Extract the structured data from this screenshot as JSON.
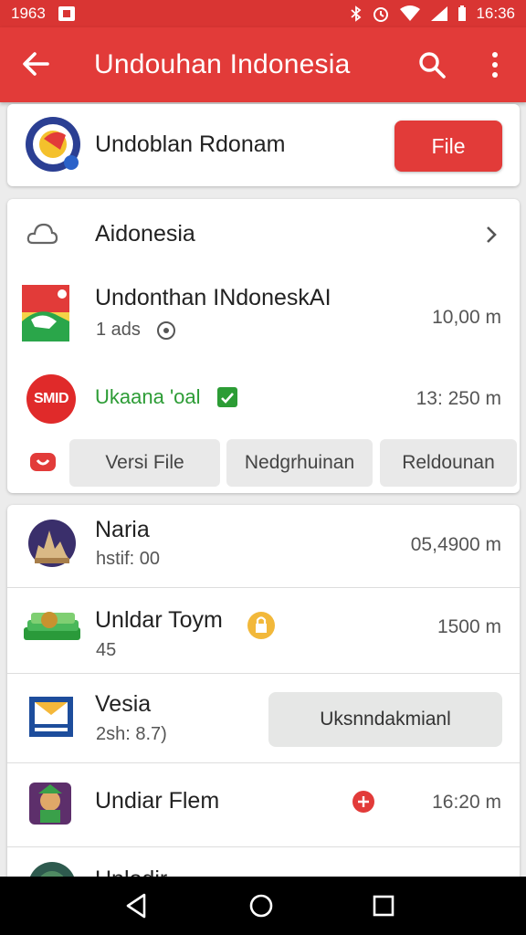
{
  "status_bar": {
    "time_left": "1963",
    "time_right": "16:36"
  },
  "app_bar": {
    "title": "Undouhan Indonesia"
  },
  "header_card": {
    "name": "Undoblan Rdonam",
    "button_label": "File"
  },
  "section": {
    "title": "Aidonesia"
  },
  "items_card2": [
    {
      "title": "Undonthan INdoneskAI",
      "subtitle": "1 ads",
      "meta": "10,00 m"
    },
    {
      "title": "Ukaana 'oal",
      "meta": "13: 250 m",
      "logo_text": "SMID"
    }
  ],
  "chips": [
    "Versi File",
    "Nedgrhuinan",
    "Reldounan"
  ],
  "list": [
    {
      "title": "Naria",
      "subtitle": "hstif: 00",
      "meta": "05,4900 m"
    },
    {
      "title": "Unldar Toym",
      "subtitle": "45",
      "meta": "1500 m"
    },
    {
      "title": "Vesia",
      "subtitle": "2sh: 8.7)",
      "button_label": "Uksnndakmianl"
    },
    {
      "title": "Undiar Flem",
      "meta": "16:20 m"
    },
    {
      "title": "Unlodir"
    }
  ],
  "colors": {
    "primary": "#e23b39",
    "status": "#d93533",
    "green": "#2c9c35"
  }
}
